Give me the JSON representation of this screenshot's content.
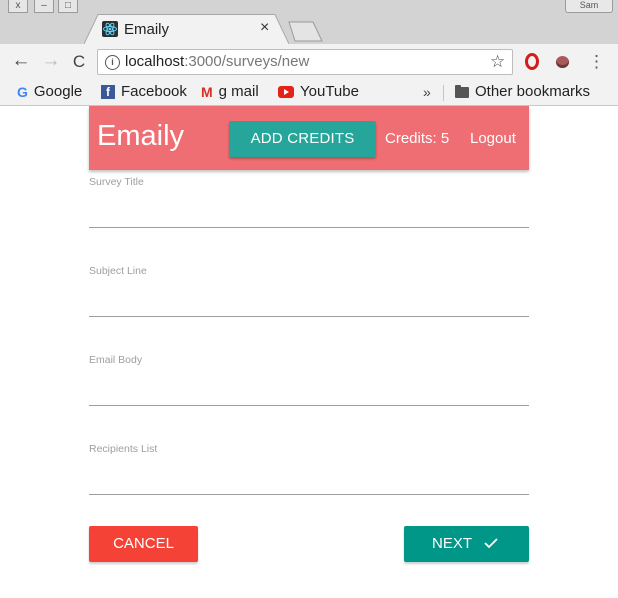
{
  "browser": {
    "tab": {
      "title": "Emaily",
      "favicon": "react-icon",
      "close": "×"
    },
    "window_controls": [
      "x",
      "–",
      "□"
    ],
    "profile_badge": "Sam",
    "toolbar": {
      "back": "←",
      "forward": "→",
      "reload": "C",
      "url_host": "localhost",
      "url_path": ":3000/surveys/new",
      "info": "i",
      "star": "☆",
      "menu": "⋮"
    },
    "bookmarks": [
      {
        "label": "Google",
        "icon": "google-icon",
        "glyph": "G"
      },
      {
        "label": "Facebook",
        "icon": "facebook-icon",
        "glyph": "f"
      },
      {
        "label": "g mail",
        "icon": "gmail-icon",
        "glyph": "M"
      },
      {
        "label": "YouTube",
        "icon": "youtube-icon",
        "glyph": ""
      }
    ],
    "bookmarks_overflow": "»",
    "other_bookmarks": "Other bookmarks"
  },
  "header": {
    "brand": "Emaily",
    "add_credits": "ADD CREDITS",
    "credits": "Credits: 5",
    "logout": "Logout",
    "color": "#ee6e73",
    "button_color": "#26a69a"
  },
  "form": {
    "fields": [
      {
        "label": "Survey Title",
        "value": ""
      },
      {
        "label": "Subject Line",
        "value": ""
      },
      {
        "label": "Email Body",
        "value": ""
      },
      {
        "label": "Recipients List",
        "value": ""
      }
    ],
    "cancel": "CANCEL",
    "next": "NEXT",
    "next_icon": "check-icon",
    "cancel_color": "#f44336",
    "next_color": "#009688"
  }
}
